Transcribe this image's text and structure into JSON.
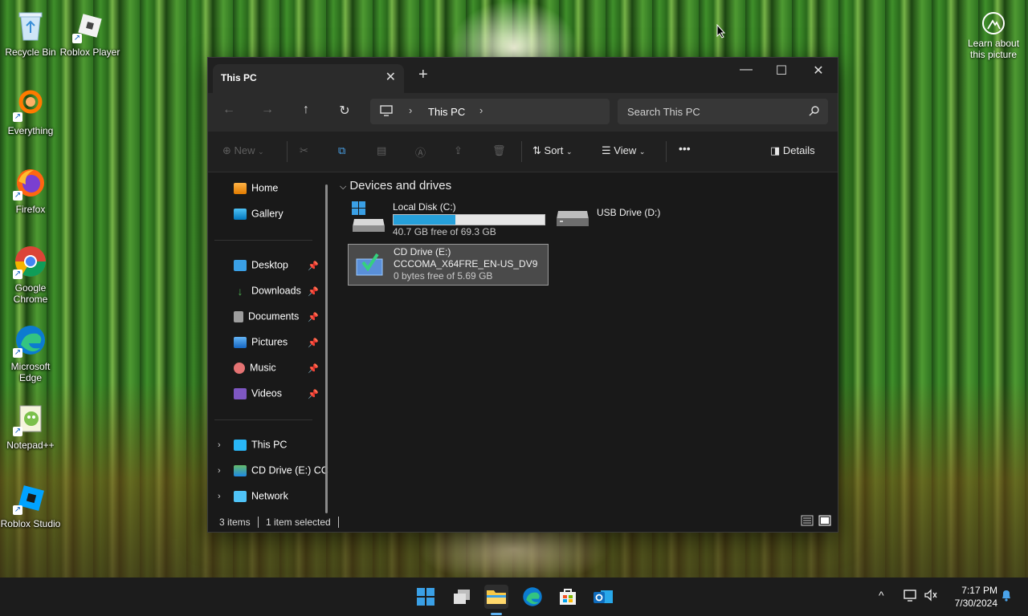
{
  "desktop": {
    "icons": [
      {
        "label": "Recycle Bin",
        "icon": "recycle-bin-icon"
      },
      {
        "label": "Roblox Player",
        "icon": "roblox-player-icon"
      },
      {
        "label": "Everything",
        "icon": "everything-search-icon"
      },
      {
        "label": "Firefox",
        "icon": "firefox-icon"
      },
      {
        "label": "Google Chrome",
        "icon": "chrome-icon"
      },
      {
        "label": "Microsoft Edge",
        "icon": "edge-icon"
      },
      {
        "label": "Notepad++",
        "icon": "notepadpp-icon"
      },
      {
        "label": "Roblox Studio",
        "icon": "roblox-studio-icon"
      }
    ],
    "learn_link": "Learn about this picture"
  },
  "explorer": {
    "tab_title": "This PC",
    "address": {
      "location": "This PC"
    },
    "search": {
      "placeholder": "Search This PC"
    },
    "commands": {
      "new": "New",
      "sort": "Sort",
      "view": "View",
      "more": "•••",
      "details": "Details"
    },
    "sidebar": {
      "top": [
        {
          "label": "Home",
          "icon": "home-icon"
        },
        {
          "label": "Gallery",
          "icon": "gallery-icon"
        }
      ],
      "pinned": [
        {
          "label": "Desktop",
          "icon": "desktop-folder-icon"
        },
        {
          "label": "Downloads",
          "icon": "downloads-icon"
        },
        {
          "label": "Documents",
          "icon": "documents-icon"
        },
        {
          "label": "Pictures",
          "icon": "pictures-icon"
        },
        {
          "label": "Music",
          "icon": "music-icon"
        },
        {
          "label": "Videos",
          "icon": "videos-icon"
        }
      ],
      "tree": [
        {
          "label": "This PC",
          "icon": "this-pc-icon"
        },
        {
          "label": "CD Drive (E:) CC",
          "icon": "cd-drive-icon"
        },
        {
          "label": "Network",
          "icon": "network-icon"
        }
      ]
    },
    "group_header": "Devices and drives",
    "drives": [
      {
        "name": "Local Disk (C:)",
        "free": "40.7 GB free of 69.3 GB",
        "used_fraction": 0.41
      },
      {
        "name": "USB Drive (D:)"
      },
      {
        "name": "CD Drive (E:)",
        "label": "CCCOMA_X64FRE_EN-US_DV9",
        "free": "0 bytes free of 5.69 GB",
        "selected": true
      }
    ],
    "status": {
      "items": "3 items",
      "selected": "1 item selected"
    }
  },
  "taskbar": {
    "time": "7:17 PM",
    "date": "7/30/2024"
  },
  "colors": {
    "accent": "#26a0da",
    "taskbar_indicator": "#5fb2f2"
  }
}
